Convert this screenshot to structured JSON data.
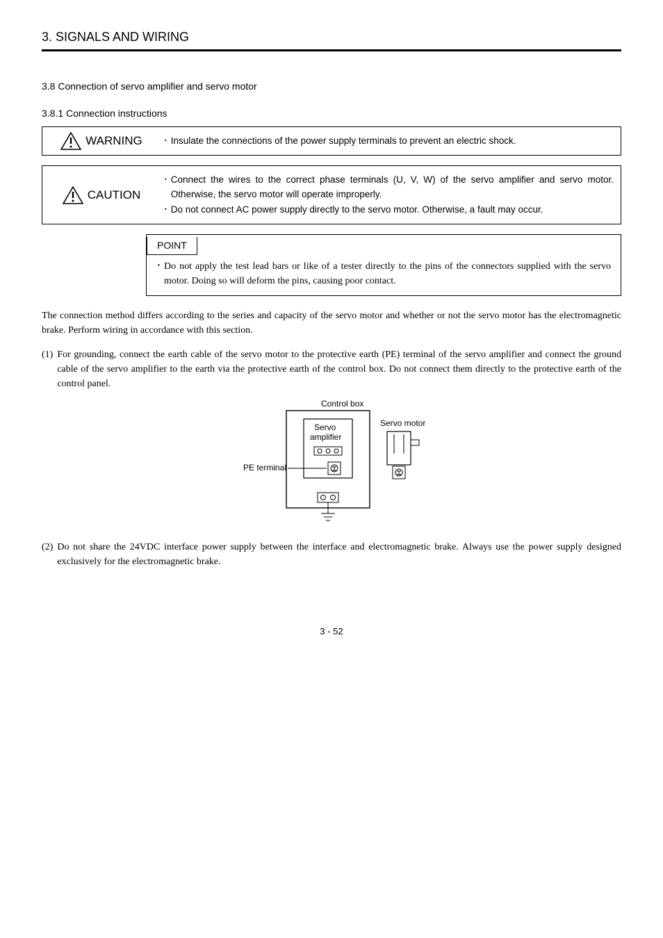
{
  "header": {
    "title": "3. SIGNALS AND WIRING"
  },
  "section": {
    "heading": "3.8 Connection of servo amplifier and servo motor",
    "subheading": "3.8.1 Connection instructions"
  },
  "warning": {
    "label": "WARNING",
    "items": [
      "Insulate the connections of the power supply terminals to prevent an electric shock."
    ]
  },
  "caution": {
    "label": "CAUTION",
    "items": [
      "Connect the wires to the correct phase terminals (U, V, W) of the servo amplifier and servo motor. Otherwise, the servo motor will operate improperly.",
      "Do not connect AC power supply directly to the servo motor. Otherwise, a fault may occur."
    ]
  },
  "point": {
    "label": "POINT",
    "items": [
      "Do not apply the test lead bars or like of a tester directly to the pins of the connectors supplied with the servo motor. Doing so will deform the pins, causing poor contact."
    ]
  },
  "paragraphs": {
    "intro": "The connection method differs according to the series and capacity of the servo motor and whether or not the servo motor has the electromagnetic brake. Perform wiring in accordance with this section.",
    "p1_num": "(1)",
    "p1": "For grounding, connect the earth cable of the servo motor to the protective earth (PE) terminal of the servo amplifier and connect the ground cable of the servo amplifier to the earth via the protective earth of the control box. Do not connect them directly to the protective earth of the control panel.",
    "p2_num": "(2)",
    "p2": "Do not share the 24VDC interface power supply between the interface and electromagnetic brake. Always use the power supply designed exclusively for the electromagnetic brake."
  },
  "diagram": {
    "control_box": "Control box",
    "servo_amplifier_l1": "Servo",
    "servo_amplifier_l2": "amplifier",
    "servo_motor": "Servo motor",
    "pe_terminal": "PE terminal"
  },
  "page_number": "3 -  52"
}
